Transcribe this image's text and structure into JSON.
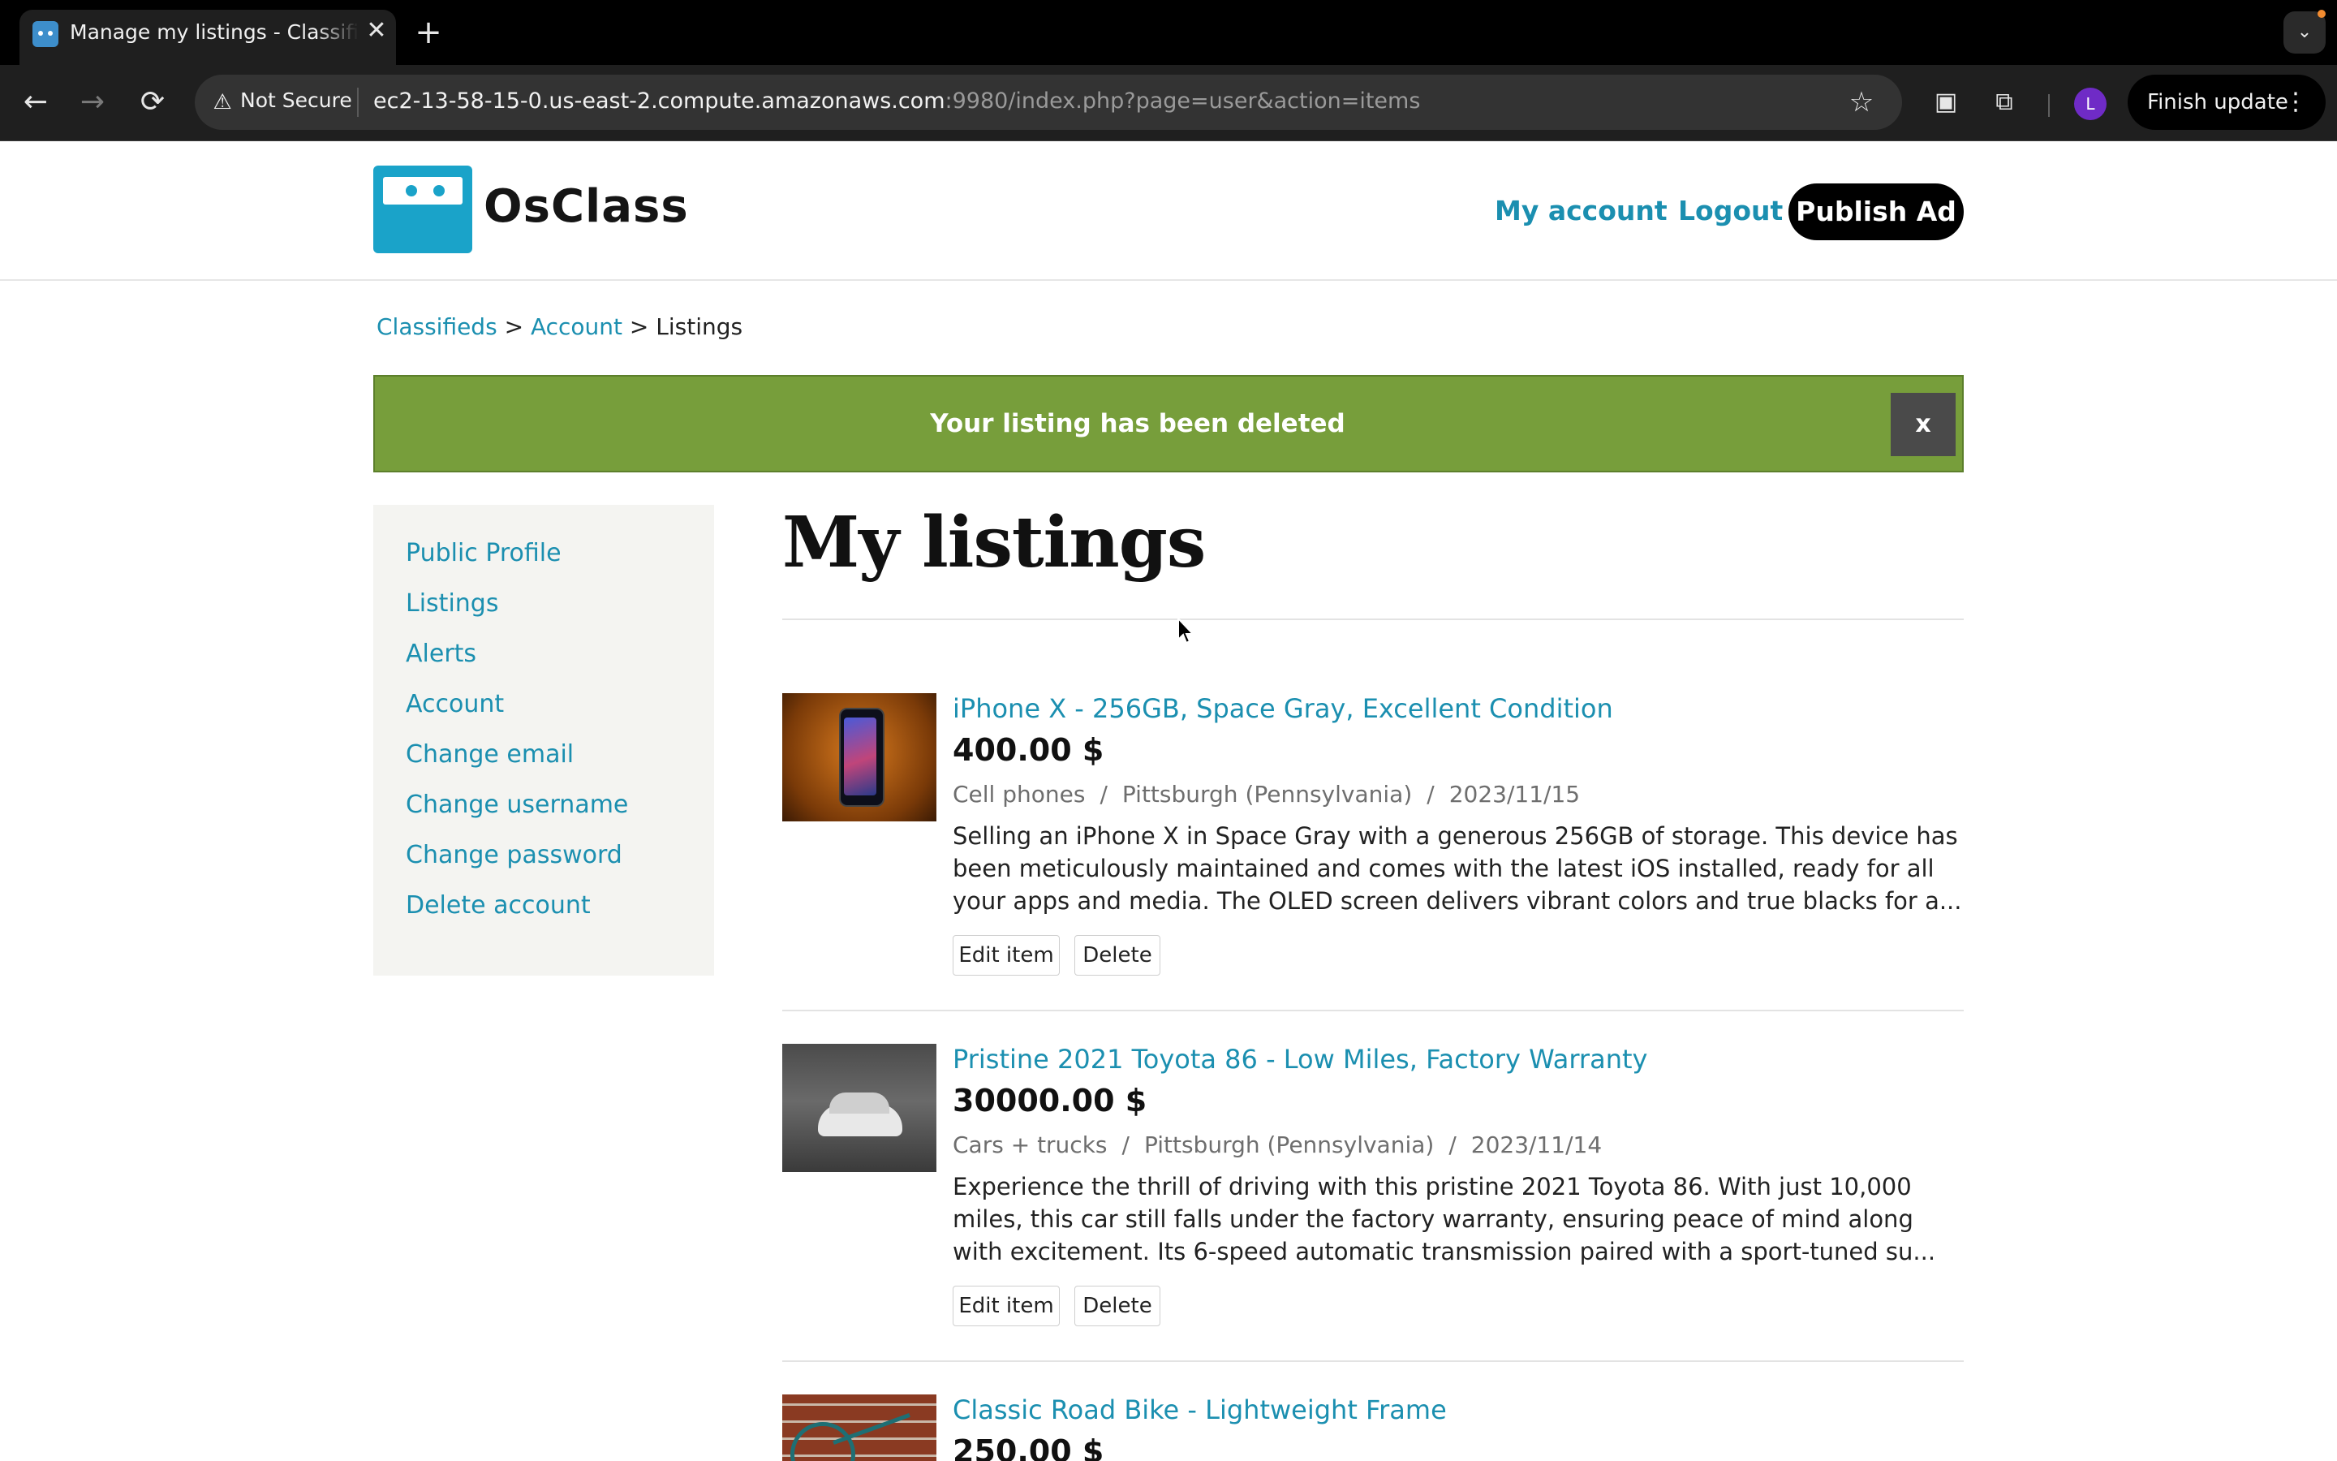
{
  "browser": {
    "tab_title": "Manage my listings - Classifieds",
    "tab_close": "✕",
    "new_tab": "+",
    "tab_search": "⌄",
    "security_label": "Not Secure",
    "url_host": "ec2-13-58-15-0.us-east-2.compute.amazonaws.com",
    "url_rest": ":9980/index.php?page=user&action=items",
    "profile_initial": "L",
    "finish_update": "Finish update"
  },
  "header": {
    "logo_text": "OsClass",
    "nav": {
      "my_account": "My account",
      "logout": "Logout",
      "publish": "Publish Ad"
    }
  },
  "breadcrumb": {
    "items": [
      "Classifieds",
      "Account",
      "Listings"
    ],
    "separator": ">"
  },
  "flash": {
    "message": "Your listing has been deleted",
    "close": "x",
    "color": "#779e3b"
  },
  "sidebar": {
    "items": [
      {
        "label": "Public Profile"
      },
      {
        "label": "Listings"
      },
      {
        "label": "Alerts"
      },
      {
        "label": "Account"
      },
      {
        "label": "Change email"
      },
      {
        "label": "Change username"
      },
      {
        "label": "Change password"
      },
      {
        "label": "Delete account"
      }
    ]
  },
  "main": {
    "title": "My listings",
    "listings": [
      {
        "title": "iPhone X - 256GB, Space Gray, Excellent Condition",
        "price": "400.00 $",
        "category": "Cell phones",
        "location": "Pittsburgh (Pennsylvania)",
        "date": "2023/11/15",
        "description": "Selling an iPhone X in Space Gray with a generous 256GB of storage. This device has been meticulously maintained and comes with the latest iOS installed, ready for all your apps and media. The OLED screen delivers vibrant colors and true blacks for a...",
        "edit_label": "Edit item",
        "delete_label": "Delete"
      },
      {
        "title": "Pristine 2021 Toyota 86 - Low Miles, Factory Warranty",
        "price": "30000.00 $",
        "category": "Cars + trucks",
        "location": "Pittsburgh (Pennsylvania)",
        "date": "2023/11/14",
        "description": "Experience the thrill of driving with this pristine 2021 Toyota 86. With just 10,000 miles, this car still falls under the factory warranty, ensuring peace of mind along with excitement. Its 6-speed automatic transmission paired with a sport-tuned su...",
        "edit_label": "Edit item",
        "delete_label": "Delete"
      },
      {
        "title": "Classic Road Bike - Lightweight Frame",
        "price": "250.00 $"
      }
    ],
    "meta_separator": "/"
  },
  "colors": {
    "link": "#1b8fb0",
    "brand": "#1aa3c9",
    "publish_bg": "#000000"
  }
}
